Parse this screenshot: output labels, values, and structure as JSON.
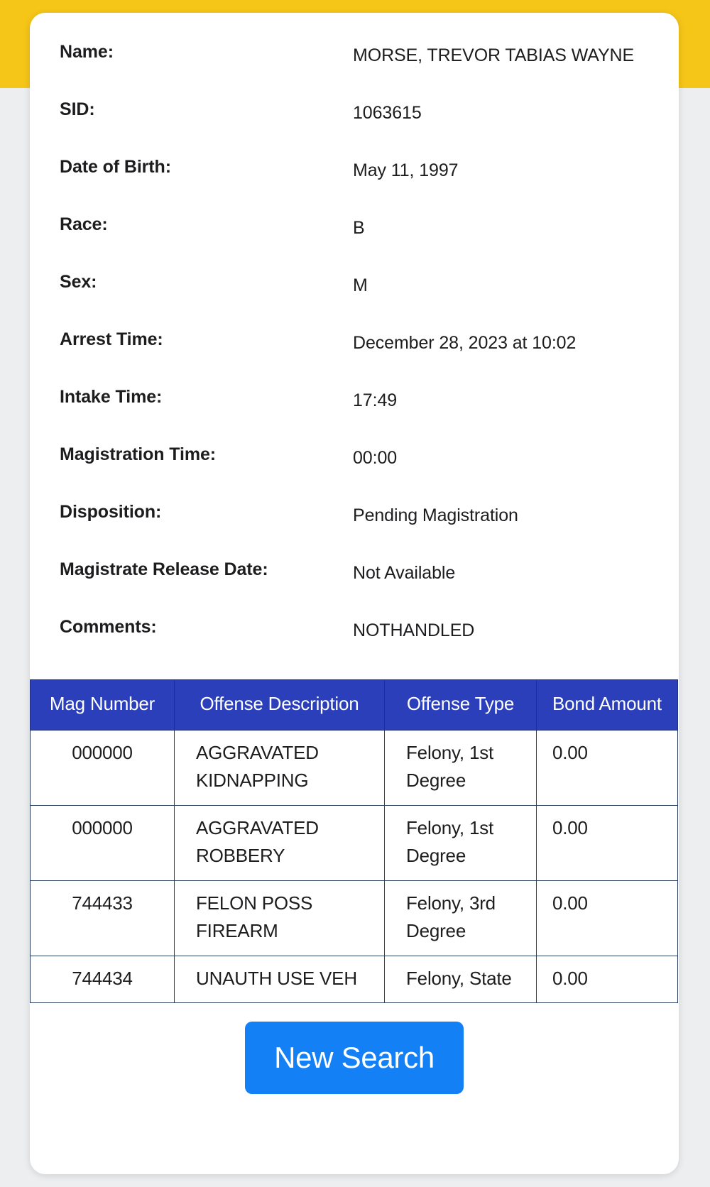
{
  "theme": {
    "banner_color": "#f5c518",
    "table_header_color": "#2b3fbb",
    "button_color": "#1380f5",
    "card_background": "#ffffff",
    "page_background": "#eceef0"
  },
  "record": {
    "fields": [
      {
        "label": "Name:",
        "value": "MORSE, TREVOR TABIAS WAYNE"
      },
      {
        "label": "SID:",
        "value": "1063615"
      },
      {
        "label": "Date of Birth:",
        "value": "May 11, 1997"
      },
      {
        "label": "Race:",
        "value": "B"
      },
      {
        "label": "Sex:",
        "value": "M"
      },
      {
        "label": "Arrest Time:",
        "value": "December 28, 2023 at 10:02"
      },
      {
        "label": "Intake Time:",
        "value": "17:49"
      },
      {
        "label": "Magistration Time:",
        "value": "00:00"
      },
      {
        "label": "Disposition:",
        "value": "Pending Magistration"
      },
      {
        "label": "Magistrate Release Date:",
        "value": "Not Available"
      },
      {
        "label": "Comments:",
        "value": "NOTHANDLED"
      }
    ]
  },
  "offense_table": {
    "headers": [
      "Mag Number",
      "Offense Description",
      "Offense Type",
      "Bond Amount"
    ],
    "rows": [
      {
        "mag_number": "000000",
        "offense_description": "AGGRAVATED KIDNAPPING",
        "offense_type": "Felony, 1st Degree",
        "bond_amount": "0.00"
      },
      {
        "mag_number": "000000",
        "offense_description": "AGGRAVATED ROBBERY",
        "offense_type": "Felony, 1st Degree",
        "bond_amount": "0.00"
      },
      {
        "mag_number": "744433",
        "offense_description": "FELON POSS FIREARM",
        "offense_type": "Felony, 3rd Degree",
        "bond_amount": "0.00"
      },
      {
        "mag_number": "744434",
        "offense_description": "UNAUTH USE VEH",
        "offense_type": "Felony, State",
        "bond_amount": "0.00"
      }
    ]
  },
  "actions": {
    "new_search_label": "New Search"
  }
}
